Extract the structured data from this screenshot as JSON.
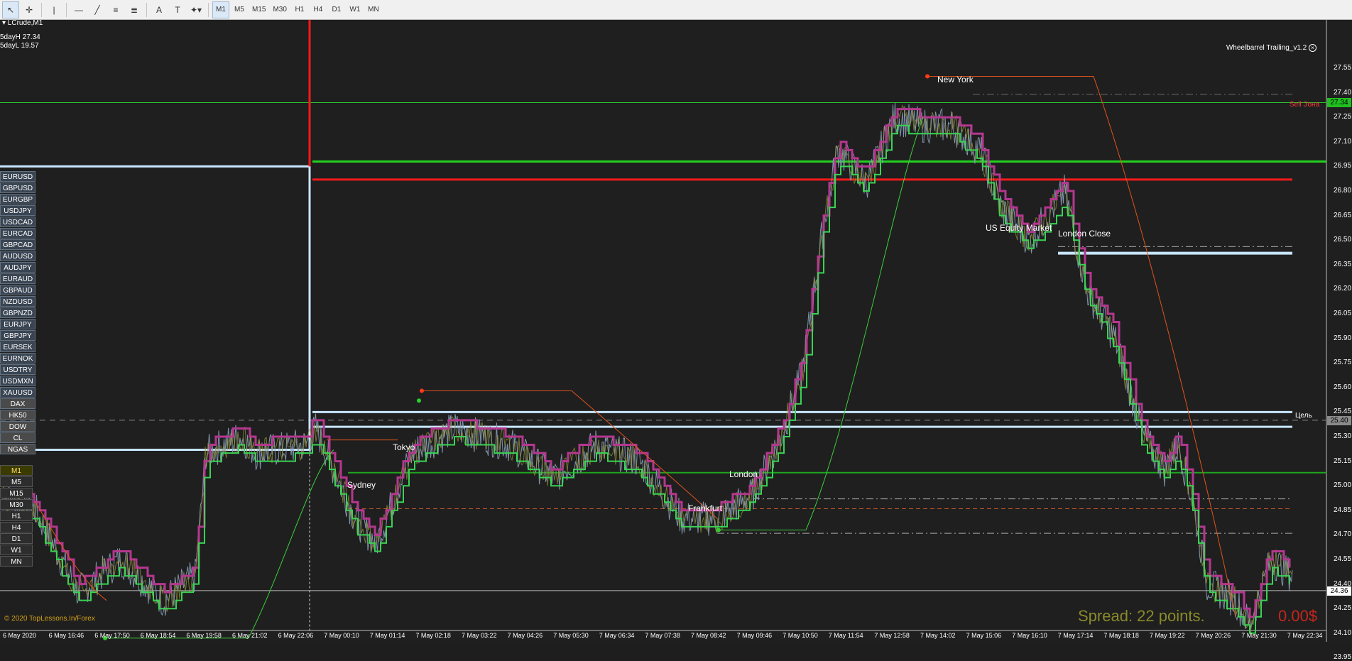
{
  "toolbar": {
    "tools": [
      {
        "name": "cursor-icon",
        "glyph": "↖"
      },
      {
        "name": "crosshair-icon",
        "glyph": "✛"
      },
      {
        "name": "vertical-line-icon",
        "glyph": "|"
      },
      {
        "name": "horizontal-line-icon",
        "glyph": "—"
      },
      {
        "name": "trendline-icon",
        "glyph": "╱"
      },
      {
        "name": "fibonacci-icon",
        "glyph": "≡"
      },
      {
        "name": "channel-icon",
        "glyph": "≣"
      },
      {
        "name": "text-icon",
        "glyph": "A"
      },
      {
        "name": "text-label-icon",
        "glyph": "T"
      },
      {
        "name": "shapes-icon",
        "glyph": "✦▾"
      }
    ],
    "timeframes": [
      "M1",
      "M5",
      "M15",
      "M30",
      "H1",
      "H4",
      "D1",
      "W1",
      "MN"
    ],
    "active_timeframe": "M1"
  },
  "chart": {
    "symbol_title": "▾ LCrude,M1",
    "five_day_high": "5dayH 27.34",
    "five_day_low": "5dayL 19.57",
    "indicator_name": "Wheelbarrel Trailing_v1.2",
    "copyright": "© 2020 TopLessons.In/Forex",
    "spread_text": "Spread: 22 points.",
    "profit_text": "0.00$",
    "sell_zone_label": "Sell Зона",
    "target_label": "Цель",
    "sessions": {
      "new_york": "New York",
      "us_equity": "US Equity Market",
      "london_close": "London Close",
      "tokyo": "Tokyo",
      "sydney": "Sydney",
      "london": "London",
      "frankfurt": "Frankfurt"
    }
  },
  "symbols": [
    "EURUSD",
    "GBPUSD",
    "EURGBP",
    "USDJPY",
    "USDCAD",
    "EURCAD",
    "GBPCAD",
    "AUDUSD",
    "AUDJPY",
    "EURAUD",
    "GBPAUD",
    "NZDUSD",
    "GBPNZD",
    "EURJPY",
    "GBPJPY",
    "EURSEK",
    "EURNOK",
    "USDTRY",
    "USDMXN",
    "XAUUSD",
    "DAX",
    "HK50",
    "DOW",
    "CL",
    "NGAS"
  ],
  "timeframe_buttons": [
    "M1",
    "M5",
    "M15",
    "M30",
    "H1",
    "H4",
    "D1",
    "W1",
    "MN"
  ],
  "price_axis": {
    "labels": [
      "27.55",
      "27.40",
      "27.25",
      "27.10",
      "26.95",
      "26.80",
      "26.65",
      "26.50",
      "26.35",
      "26.20",
      "26.05",
      "25.90",
      "25.75",
      "25.60",
      "25.45",
      "25.30",
      "25.15",
      "25.00",
      "24.85",
      "24.70",
      "24.55",
      "24.40",
      "24.25",
      "24.10",
      "23.95"
    ],
    "badge_high": "27.34",
    "badge_target": "25.40",
    "badge_current": "24.36"
  },
  "time_axis": {
    "labels": [
      "6 May 2020",
      "6 May 16:46",
      "6 May 17:50",
      "6 May 18:54",
      "6 May 19:58",
      "6 May 21:02",
      "6 May 22:06",
      "7 May 00:10",
      "7 May 01:14",
      "7 May 02:18",
      "7 May 03:22",
      "7 May 04:26",
      "7 May 05:30",
      "7 May 06:34",
      "7 May 07:38",
      "7 May 08:42",
      "7 May 09:46",
      "7 May 10:50",
      "7 May 11:54",
      "7 May 12:58",
      "7 May 14:02",
      "7 May 15:06",
      "7 May 16:10",
      "7 May 17:14",
      "7 May 18:18",
      "7 May 19:22",
      "7 May 20:26",
      "7 May 21:30",
      "7 May 22:34"
    ]
  },
  "colors": {
    "background": "#1f1f1f",
    "bid_line": "#9fb7c4",
    "green_step": "#39d353",
    "magenta_step": "#b4378f",
    "red_level": "#ff1a1a",
    "green_level": "#23d11f",
    "light_blue_level": "#c8e6ff",
    "orange_curve": "#e0541c"
  }
}
